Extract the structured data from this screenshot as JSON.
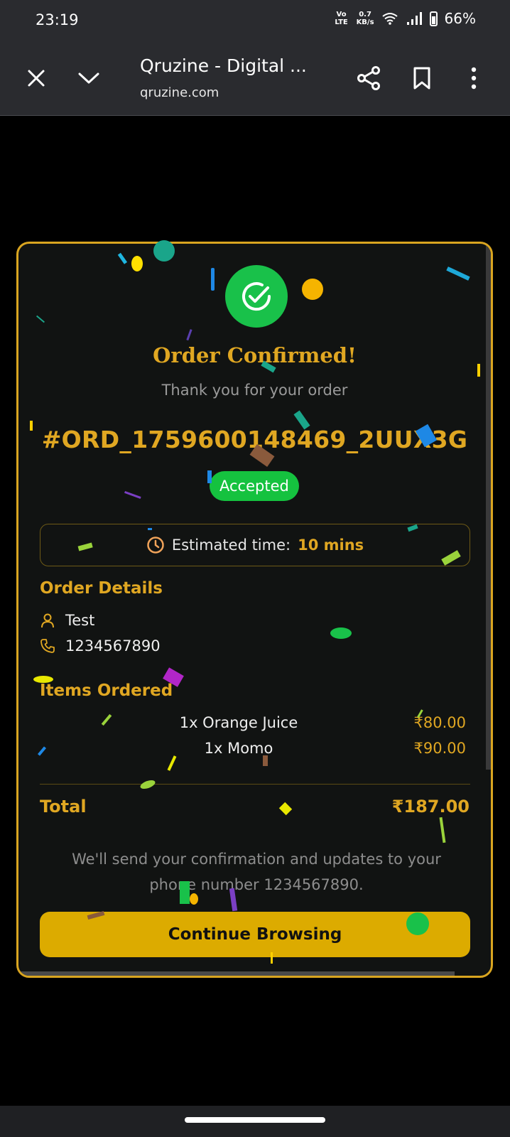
{
  "status_bar": {
    "time": "23:19",
    "network_type": "Vo LTE",
    "speed_value": "0.7",
    "speed_unit": "KB/s",
    "battery": "66%"
  },
  "browser": {
    "close_icon": "close-icon",
    "title": "Qruzine - Digital ...",
    "url": "qruzine.com"
  },
  "order": {
    "title": "Order Confirmed!",
    "subtitle": "Thank you for your order",
    "id": "#ORD_1759600148469_2UUX3G",
    "status": "Accepted",
    "eta_label": "Estimated time:",
    "eta_value": "10 mins"
  },
  "details": {
    "heading": "Order Details",
    "name": "Test",
    "phone": "1234567890"
  },
  "items": {
    "heading": "Items Ordered",
    "list": [
      {
        "name": "1x Orange Juice",
        "price": "₹80.00"
      },
      {
        "name": "1x Momo",
        "price": "₹90.00"
      }
    ]
  },
  "total": {
    "label": "Total",
    "value": "₹187.00"
  },
  "note": "We'll send your confirmation and updates to your phone number 1234567890.",
  "continue_label": "Continue Browsing",
  "colors": {
    "accent": "#e0a722",
    "success": "#19c14a",
    "button": "#dcab00",
    "background": "#111312"
  }
}
